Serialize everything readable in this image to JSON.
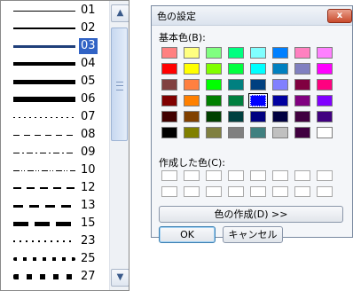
{
  "line_list": {
    "items": [
      {
        "label": "01",
        "style": "solid",
        "width": 1,
        "selected": false
      },
      {
        "label": "02",
        "style": "solid",
        "width": 2,
        "selected": false
      },
      {
        "label": "03",
        "style": "solid",
        "width": 3,
        "selected": true
      },
      {
        "label": "04",
        "style": "solid",
        "width": 4,
        "selected": false
      },
      {
        "label": "05",
        "style": "solid",
        "width": 5,
        "selected": false
      },
      {
        "label": "06",
        "style": "solid",
        "width": 6,
        "selected": false
      },
      {
        "label": "07",
        "style": "dotted",
        "width": 1,
        "selected": false
      },
      {
        "label": "08",
        "style": "dashed",
        "width": 1,
        "selected": false
      },
      {
        "label": "09",
        "style": "dashdot",
        "width": 1,
        "selected": false
      },
      {
        "label": "10",
        "style": "dashdotdot",
        "width": 1,
        "selected": false
      },
      {
        "label": "12",
        "style": "dashed",
        "width": 2,
        "selected": false
      },
      {
        "label": "13",
        "style": "dashed",
        "width": 3,
        "selected": false
      },
      {
        "label": "15",
        "style": "longdash",
        "width": 5,
        "selected": false
      },
      {
        "label": "23",
        "style": "dotted",
        "width": 2,
        "selected": false
      },
      {
        "label": "25",
        "style": "dotted",
        "width": 4,
        "selected": false
      },
      {
        "label": "27",
        "style": "dotted",
        "width": 6,
        "selected": false
      }
    ],
    "scrollbar": {
      "up_icon": "▲",
      "down_icon": "▼"
    }
  },
  "color_dialog": {
    "title": "色の設定",
    "close_label": "x",
    "basic_colors_label": "基本色(B):",
    "basic_colors": [
      [
        "#ff8080",
        "#ffff80",
        "#80ff80",
        "#00ff80",
        "#80ffff",
        "#0080ff",
        "#ff80c0",
        "#ff80ff"
      ],
      [
        "#ff0000",
        "#ffff00",
        "#80ff00",
        "#00ff40",
        "#00ffff",
        "#0080c0",
        "#8080c0",
        "#ff00ff"
      ],
      [
        "#804040",
        "#ff8040",
        "#00ff00",
        "#008080",
        "#004080",
        "#8080ff",
        "#800040",
        "#ff0080"
      ],
      [
        "#800000",
        "#ff8000",
        "#008000",
        "#008040",
        "#0000ff",
        "#0000a0",
        "#800080",
        "#8000ff"
      ],
      [
        "#400000",
        "#804000",
        "#004000",
        "#004040",
        "#000080",
        "#000040",
        "#400040",
        "#400080"
      ],
      [
        "#000000",
        "#808000",
        "#808040",
        "#808080",
        "#408080",
        "#c0c0c0",
        "#400040",
        "#ffffff"
      ]
    ],
    "selected_color": {
      "row": 3,
      "col": 4
    },
    "custom_colors_label": "作成した色(C):",
    "custom_colors": [
      [
        "#ffffff",
        "#ffffff",
        "#ffffff",
        "#ffffff",
        "#ffffff",
        "#ffffff",
        "#ffffff",
        "#ffffff"
      ],
      [
        "#ffffff",
        "#ffffff",
        "#ffffff",
        "#ffffff",
        "#ffffff",
        "#ffffff",
        "#ffffff",
        "#ffffff"
      ]
    ],
    "define_custom_label": "色の作成(D) >>",
    "ok_label": "OK",
    "cancel_label": "キャンセル"
  }
}
